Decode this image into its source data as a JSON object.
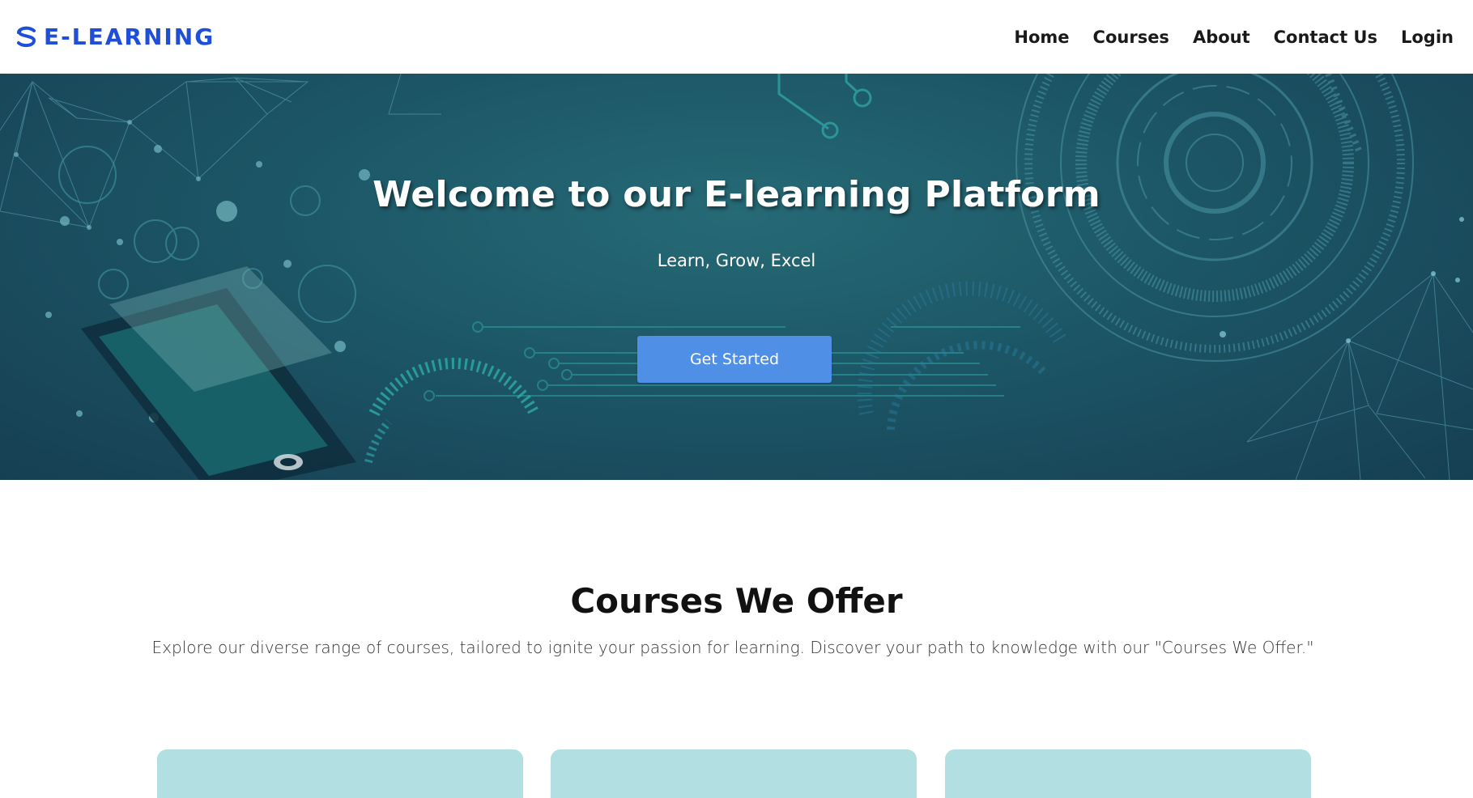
{
  "brand": {
    "name": "E-LEARNING",
    "color": "#1f4fd8",
    "logo_icon": "brand-s-logo-icon"
  },
  "nav": {
    "items": [
      {
        "label": "Home"
      },
      {
        "label": "Courses"
      },
      {
        "label": "About"
      },
      {
        "label": "Contact Us"
      },
      {
        "label": "Login"
      }
    ]
  },
  "hero": {
    "title": "Welcome to our E-learning Platform",
    "subtitle": "Learn, Grow, Excel",
    "button_label": "Get Started",
    "background_color": "#1c5666",
    "button_color": "#4f8fe6"
  },
  "courses": {
    "title": "Courses We Offer",
    "description": "Explore our diverse range of courses, tailored to ignite your passion for learning. Discover your path to knowledge with our \"Courses We Offer.\"",
    "card_color": "#b1dfe2"
  }
}
